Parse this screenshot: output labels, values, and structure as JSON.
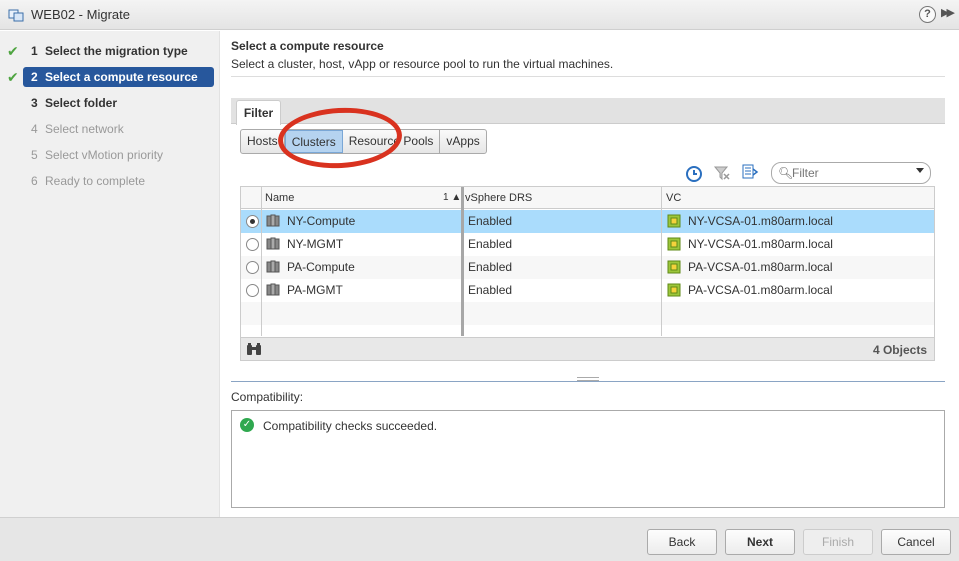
{
  "window": {
    "title": "WEB02 - Migrate",
    "help_label": "?",
    "expand_label": "▶▶"
  },
  "steps": [
    {
      "num": "1",
      "label": "Select the migration type",
      "state": "done"
    },
    {
      "num": "2",
      "label": "Select a compute resource",
      "state": "current"
    },
    {
      "num": "3",
      "label": "Select folder",
      "state": "next"
    },
    {
      "num": "4",
      "label": "Select network",
      "state": "future"
    },
    {
      "num": "5",
      "label": "Select vMotion priority",
      "state": "future"
    },
    {
      "num": "6",
      "label": "Ready to complete",
      "state": "future"
    }
  ],
  "main": {
    "heading": "Select a compute resource",
    "subheading": "Select a cluster, host, vApp or resource pool to run the virtual machines.",
    "filter_tab": "Filter",
    "segments": [
      "Hosts",
      "Clusters",
      "Resource Pools",
      "vApps"
    ],
    "active_segment": "Clusters",
    "filter_placeholder": "Filter",
    "grid": {
      "columns": [
        "Name",
        "vSphere DRS",
        "VC"
      ],
      "sort_indicator": "1 ▲",
      "rows": [
        {
          "name": "NY-Compute",
          "drs": "Enabled",
          "vc": "NY-VCSA-01.m80arm.local",
          "selected": true
        },
        {
          "name": "NY-MGMT",
          "drs": "Enabled",
          "vc": "NY-VCSA-01.m80arm.local",
          "selected": false
        },
        {
          "name": "PA-Compute",
          "drs": "Enabled",
          "vc": "PA-VCSA-01.m80arm.local",
          "selected": false
        },
        {
          "name": "PA-MGMT",
          "drs": "Enabled",
          "vc": "PA-VCSA-01.m80arm.local",
          "selected": false
        }
      ],
      "object_count": "4 Objects"
    },
    "compatibility_label": "Compatibility:",
    "compatibility_message": "Compatibility checks succeeded."
  },
  "footer": {
    "back": "Back",
    "next": "Next",
    "finish": "Finish",
    "cancel": "Cancel"
  },
  "colors": {
    "step_highlight": "#27579c",
    "selected_row": "#aadcfc",
    "annotation_oval": "#d9321f",
    "success": "#2fa84f"
  }
}
